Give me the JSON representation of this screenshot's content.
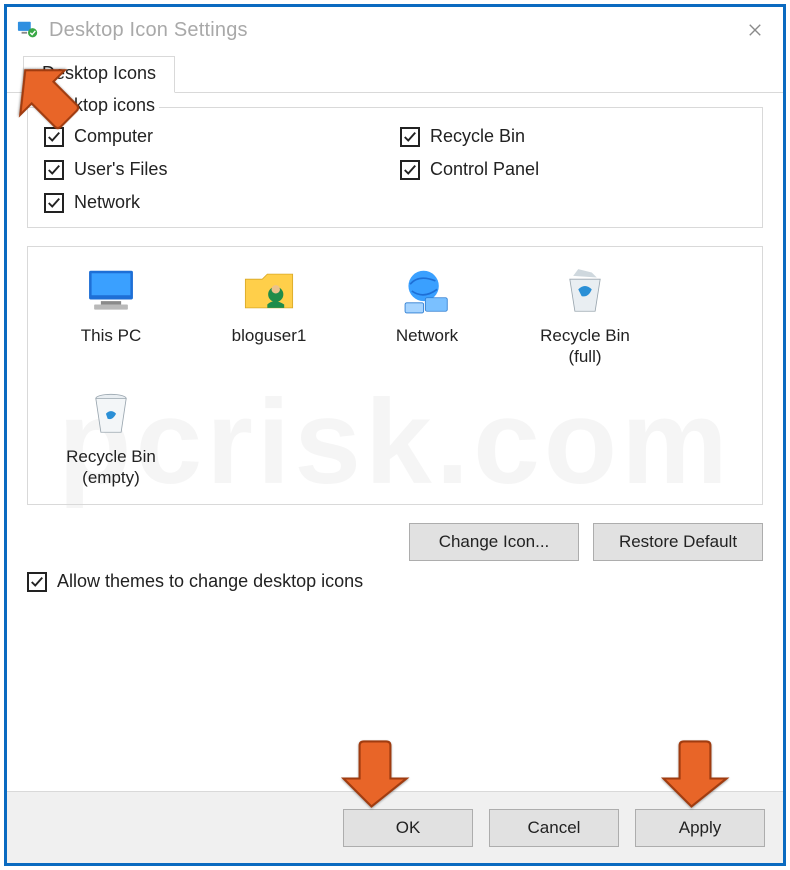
{
  "window": {
    "title": "Desktop Icon Settings"
  },
  "tabs": [
    {
      "label": "Desktop Icons"
    }
  ],
  "group": {
    "legend": "Desktop icons",
    "checks": [
      {
        "label": "Computer",
        "checked": true
      },
      {
        "label": "Recycle Bin",
        "checked": true
      },
      {
        "label": "User's Files",
        "checked": true
      },
      {
        "label": "Control Panel",
        "checked": true
      },
      {
        "label": "Network",
        "checked": true
      }
    ]
  },
  "icons": [
    {
      "label": "This PC",
      "glyph": "pc"
    },
    {
      "label": "bloguser1",
      "glyph": "user"
    },
    {
      "label": "Network",
      "glyph": "network"
    },
    {
      "label": "Recycle Bin\n(full)",
      "glyph": "bin-full"
    },
    {
      "label": "Recycle Bin\n(empty)",
      "glyph": "bin-empty"
    }
  ],
  "buttons": {
    "change_icon": "Change Icon...",
    "restore_default": "Restore Default",
    "ok": "OK",
    "cancel": "Cancel",
    "apply": "Apply"
  },
  "allow_themes": {
    "label": "Allow themes to change desktop icons",
    "checked": true
  },
  "watermark": "pcrisk.com",
  "colors": {
    "window_border": "#0a6ac0",
    "arrow_fill": "#e86528"
  }
}
